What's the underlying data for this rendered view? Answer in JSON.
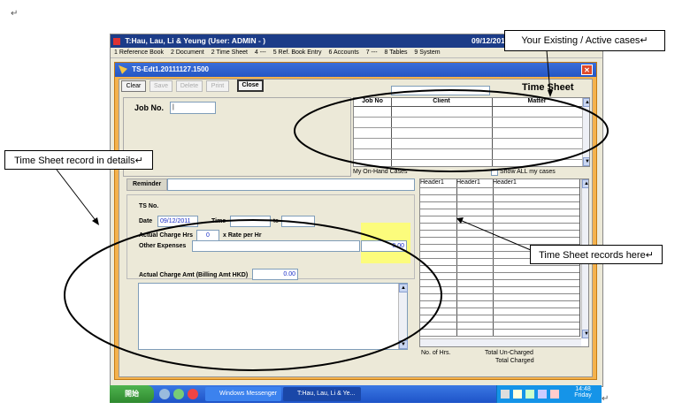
{
  "doc": {
    "para_mark": "↵"
  },
  "app": {
    "title": "T:Hau, Lau, Li & Yeung  (User: ADMIN - )",
    "date": "09/12/2011",
    "menu": [
      "1 Reference Book",
      "2 Document",
      "2 Time Sheet",
      "4 ---",
      "5 Ref. Book Entry",
      "6 Accounts",
      "7 ---",
      "8 Tables",
      "9 System"
    ]
  },
  "window": {
    "title": "TS-Edt1.20111127.1500",
    "close_label": "✕",
    "toolbar": {
      "clear": "Clear",
      "save": "Save",
      "delete": "Delete",
      "print": "Print",
      "close": "Close"
    },
    "heading": "Time Sheet",
    "job_no_label": "Job No.",
    "job_no_value": "|",
    "cases_table": {
      "headers": [
        "Job No",
        "Client",
        "Matter"
      ]
    },
    "my_on_hand_label": "My On-Hand Cases",
    "show_all_label": "Show ALL my cases",
    "reminder_label": "Reminder",
    "ts_no_label": "TS No.",
    "date_label": "Date",
    "date_value": "09/12/2011",
    "time_label": "Time",
    "to_label": "to",
    "actual_charge_hrs_label": "Actual Charge Hrs",
    "actual_charge_hrs_value": "0",
    "rate_label": "x Rate per Hr",
    "other_expenses_label": "Other Expenses",
    "other_expenses_value": "0.00",
    "actual_charge_amt_label": "Actual Charge Amt (Billing Amt HKD)",
    "actual_charge_amt_value": "0.00",
    "records_table": {
      "headers": [
        "Header1",
        "Header1",
        "Header1"
      ]
    },
    "no_of_hrs_label": "No. of Hrs.",
    "total_uncharged_label": "Total Un-Charged",
    "total_charged_label": "Total Charged"
  },
  "callouts": {
    "existing_cases": "Your Existing / Active cases↵",
    "record_details": "Time Sheet record in details↵",
    "records_here": "Time Sheet records here↵"
  },
  "taskbar": {
    "start": "開始",
    "tasks": [
      "Windows Messenger",
      "T:Hau, Lau, Li & Ye..."
    ],
    "clock_time": "14:48",
    "clock_day": "Friday"
  }
}
